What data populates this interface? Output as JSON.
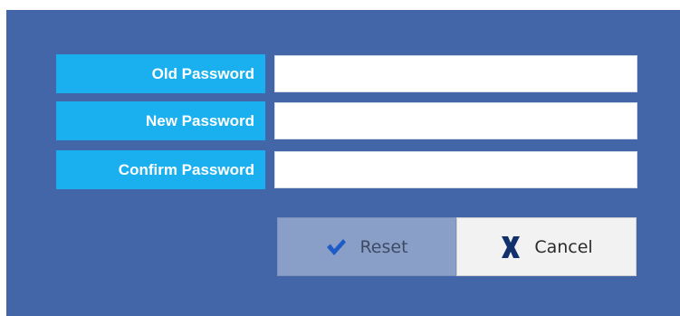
{
  "form": {
    "old_password": {
      "label": "Old Password",
      "value": "",
      "placeholder": ""
    },
    "new_password": {
      "label": "New Password",
      "value": "",
      "placeholder": ""
    },
    "confirm_password": {
      "label": "Confirm Password",
      "value": "",
      "placeholder": ""
    }
  },
  "buttons": {
    "reset_label": "Reset",
    "reset_icon": "checkmark-icon",
    "cancel_label": "Cancel",
    "cancel_icon": "close-icon"
  },
  "colors": {
    "panel_background": "#4366a8",
    "label_background": "#1ab0ef",
    "label_text": "#ffffff",
    "reset_background": "#8a9fc7",
    "reset_icon": "#1e5bc6",
    "cancel_background": "#f2f2f2",
    "cancel_icon": "#12306b"
  }
}
